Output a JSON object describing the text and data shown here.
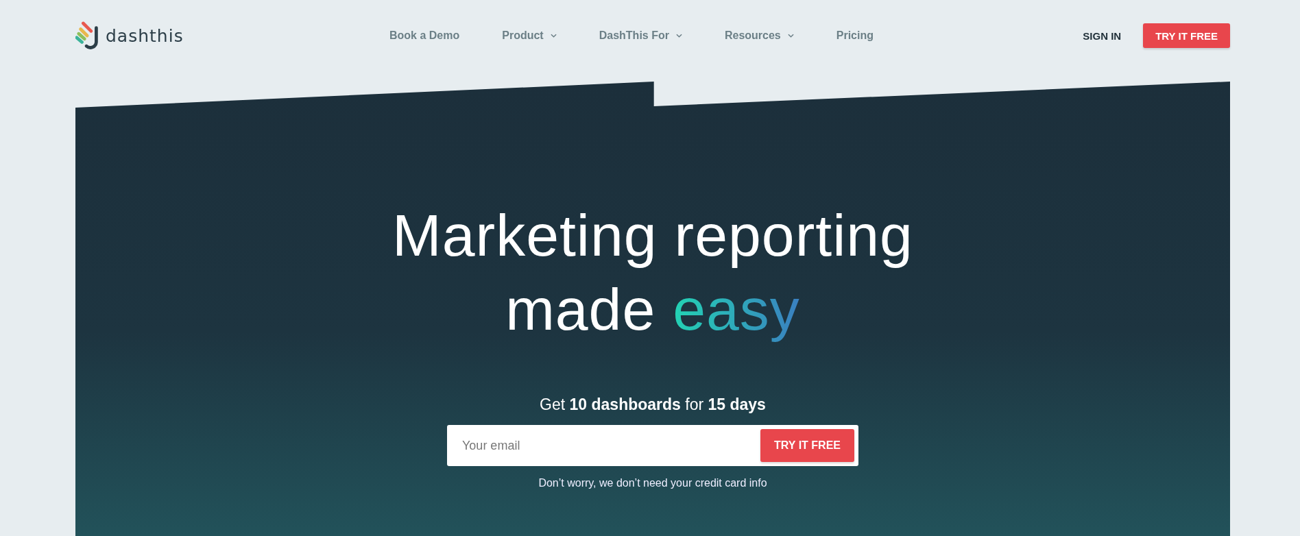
{
  "header": {
    "logo": "dashthis",
    "nav": [
      {
        "label": "Book a Demo",
        "dropdown": false
      },
      {
        "label": "Product",
        "dropdown": true
      },
      {
        "label": "DashThis For",
        "dropdown": true
      },
      {
        "label": "Resources",
        "dropdown": true
      },
      {
        "label": "Pricing",
        "dropdown": false
      }
    ],
    "sign_in": "SIGN IN",
    "cta": "TRY IT FREE"
  },
  "hero": {
    "headline": [
      "Marketing reporting",
      "made "
    ],
    "highlight": "easy",
    "offer": "Get **10 dashboards** for **15 days**",
    "email": {
      "placeholder": "Your email"
    },
    "cta": "TRY IT FREE",
    "note": "Don’t worry, we don’t need your credit card info"
  }
}
